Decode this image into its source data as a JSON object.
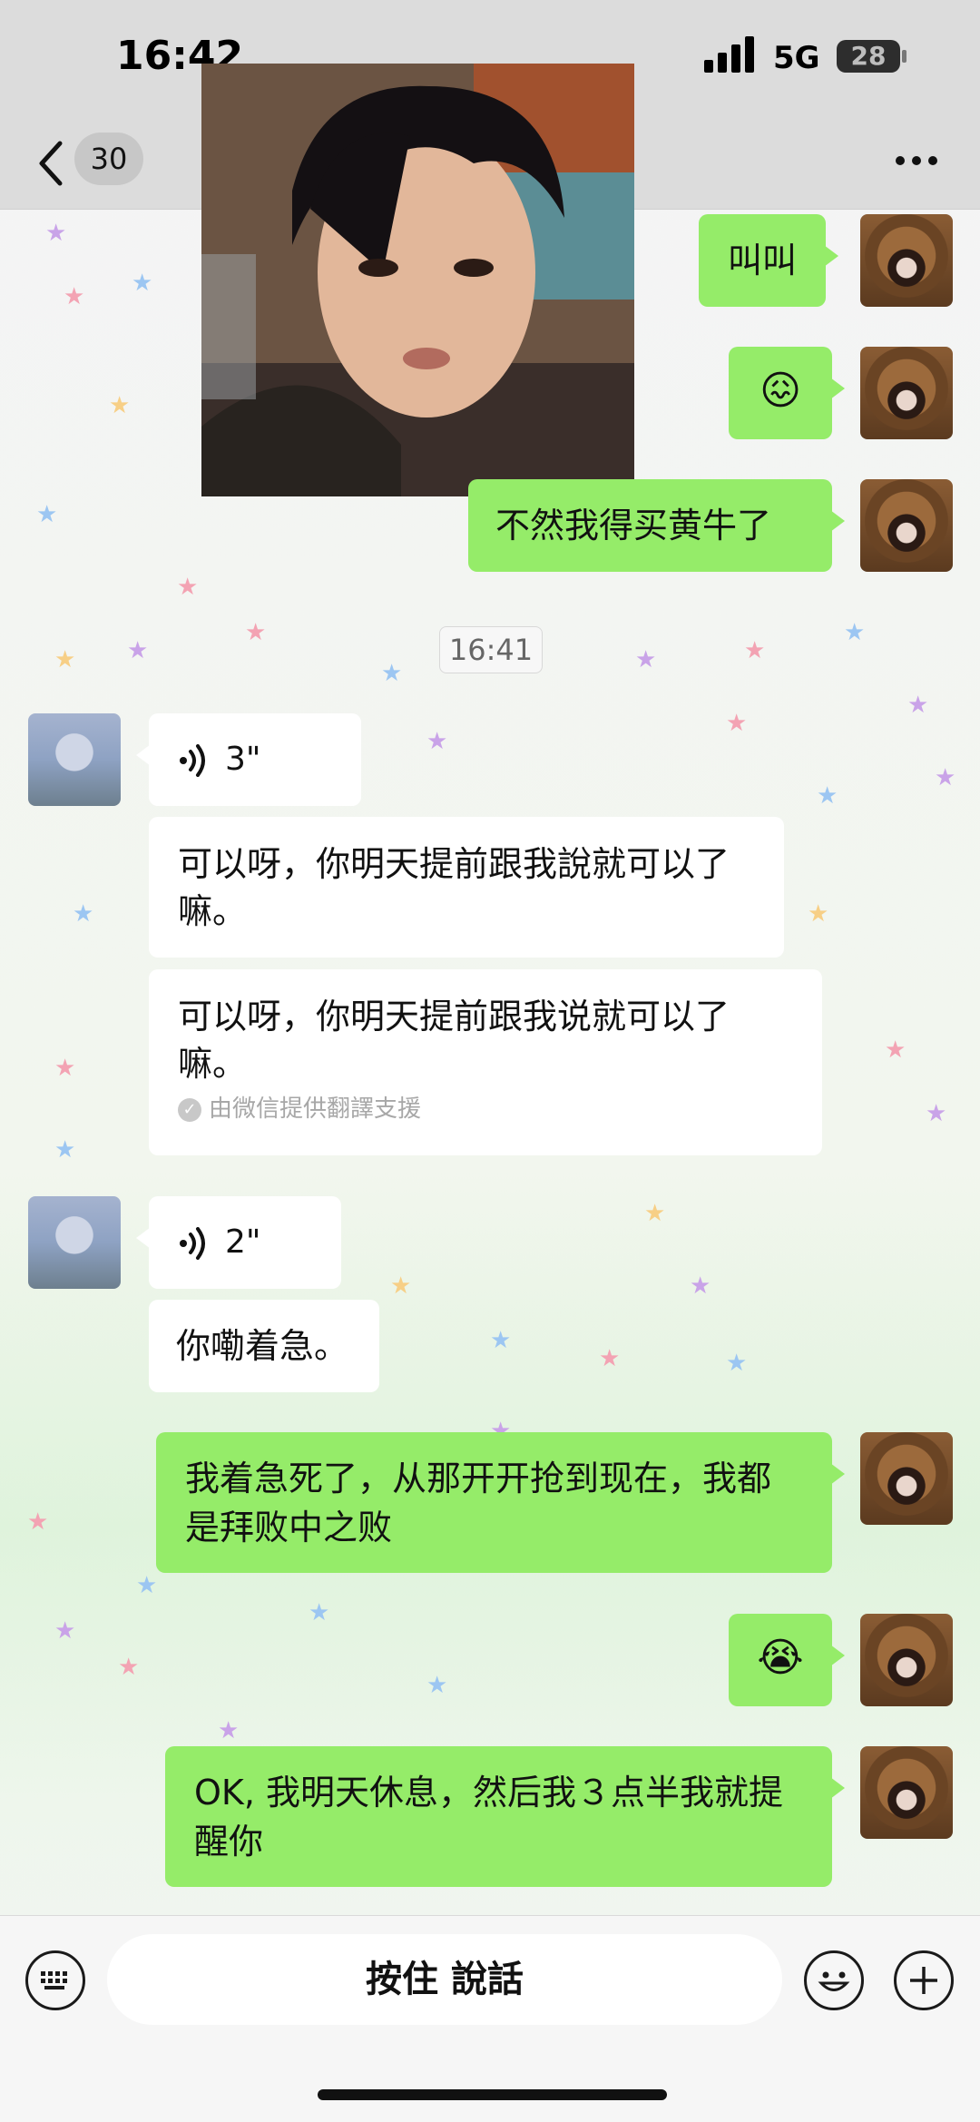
{
  "status_bar": {
    "time": "16:42",
    "network": "5G",
    "battery": "28"
  },
  "nav": {
    "unread_count": "30"
  },
  "messages": {
    "m1": "叫叫",
    "m2": "😖",
    "m3": "不然我得买黄牛了",
    "timestamp": "16:41",
    "voice1_duration": "3\"",
    "voice1_text": "可以呀，你明天提前跟我說就可以了嘛。",
    "voice1_translation": "可以呀，你明天提前跟我说就可以了嘛。",
    "translation_note": "由微信提供翻譯支援",
    "voice2_duration": "2\"",
    "voice2_text": "你嘞着急。",
    "m4": "我着急死了，从那开开抢到现在，我都是拜败中之败",
    "m5": "😭",
    "m6": "OK, 我明天休息，然后我３点半我就提醒你"
  },
  "input": {
    "hold_to_talk": "按住 說話"
  },
  "icons": {
    "back": "chevron-left-icon",
    "more": "more-dots-icon",
    "keyboard": "keyboard-icon",
    "emoji": "emoji-icon",
    "plus": "plus-icon",
    "voice": "voice-wave-icon"
  }
}
